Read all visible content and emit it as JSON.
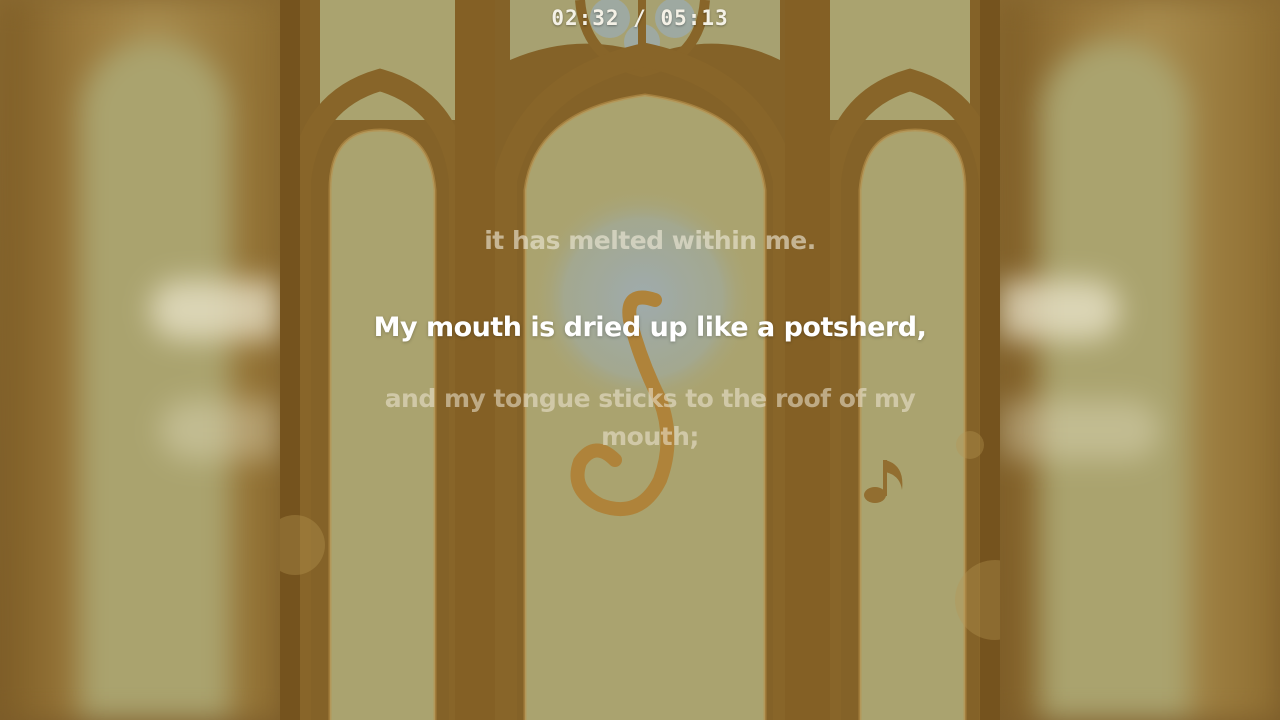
{
  "player": {
    "elapsed": "02:32",
    "duration": "05:13",
    "time_display": "02:32 / 05:13"
  },
  "lyrics": {
    "previous": "it has melted within me.",
    "current": "My mouth is dried up like a potsherd,",
    "next": "and my tongue sticks to the roof of my mouth;"
  },
  "artwork": {
    "description_icons": [
      "gothic-window-arches",
      "treble-clef-icon",
      "music-note-icon"
    ],
    "colors": {
      "frame": "#8f6a2c",
      "frame_dark": "#7a5620",
      "glass": "#b3ad78",
      "glow": "#a9b6b7",
      "accent": "#b98a3e"
    }
  }
}
